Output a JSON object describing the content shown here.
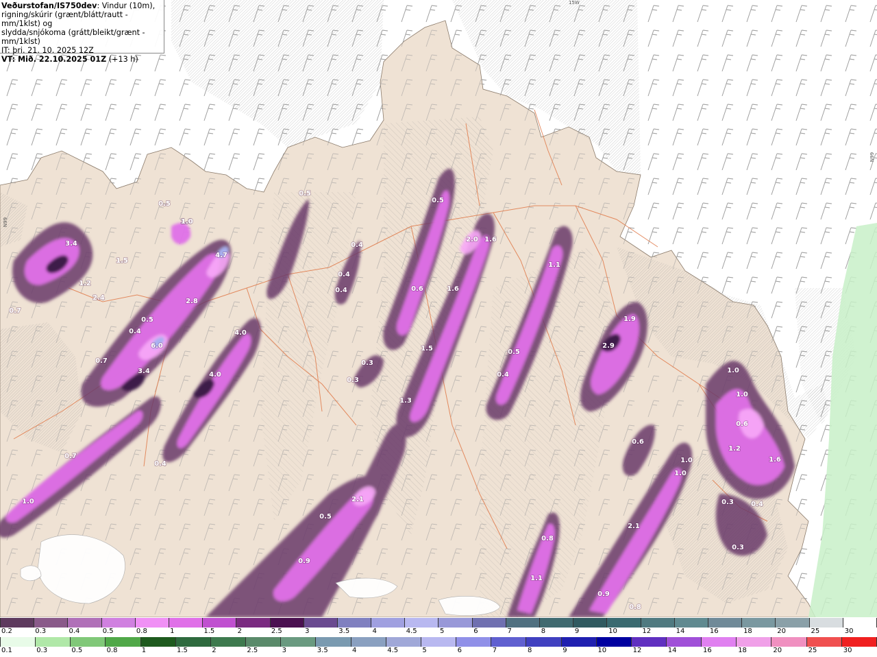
{
  "info": {
    "brand": "Veðurstofan/IS750dev",
    "line1_rest": ": Vindur (10m),",
    "line2": "rigning/skúrir (grænt/blátt/rautt - mm/1klst) og",
    "line3": "slydda/snjókoma (grátt/bleikt/grænt - mm/1klst)",
    "it": "IT: þri. 21. 10. 2025 12Z",
    "vt": "VT: Mið. 22.10.2025 01Z",
    "vt_offset": " (+13 h)"
  },
  "edge_labels": {
    "top": "15W",
    "left": "N99",
    "right": "N99"
  },
  "colors": {
    "sea": "#ffffff",
    "land": "#efe2d4",
    "roads": "#e07a4a",
    "hatch": "#888888",
    "precip_light": "#8a5a8f",
    "precip_mid": "#e070e8",
    "precip_strong": "#f5a0f5",
    "precip_core": "#4a1a50",
    "rain_green": "#c8f0c8"
  },
  "map_labels": [
    {
      "name": "precip-value",
      "text": "0.5"
    },
    {
      "name": "precip-value",
      "text": "1.0"
    },
    {
      "name": "precip-value",
      "text": "0.5"
    },
    {
      "name": "precip-value",
      "text": "3.4"
    },
    {
      "name": "precip-value",
      "text": "1.5"
    },
    {
      "name": "precip-value",
      "text": "1.2"
    },
    {
      "name": "precip-value",
      "text": "2.4"
    },
    {
      "name": "precip-value",
      "text": "0.7"
    },
    {
      "name": "precip-value",
      "text": "4.7"
    },
    {
      "name": "precip-value",
      "text": "2.8"
    },
    {
      "name": "precip-value",
      "text": "0.5"
    },
    {
      "name": "precip-value",
      "text": "0.4"
    },
    {
      "name": "precip-value",
      "text": "6.0"
    },
    {
      "name": "precip-value",
      "text": "0.7"
    },
    {
      "name": "precip-value",
      "text": "3.4"
    },
    {
      "name": "precip-value",
      "text": "4.0"
    },
    {
      "name": "precip-value",
      "text": "4.0"
    },
    {
      "name": "precip-value",
      "text": "0.4"
    },
    {
      "name": "precip-value",
      "text": "0.4"
    },
    {
      "name": "precip-value",
      "text": "0.4"
    },
    {
      "name": "precip-value",
      "text": "0.5"
    },
    {
      "name": "precip-value",
      "text": "2.0"
    },
    {
      "name": "precip-value",
      "text": "1.6"
    },
    {
      "name": "precip-value",
      "text": "0.6"
    },
    {
      "name": "precip-value",
      "text": "1.6"
    },
    {
      "name": "precip-value",
      "text": "1.1"
    },
    {
      "name": "precip-value",
      "text": "1.5"
    },
    {
      "name": "precip-value",
      "text": "0.3"
    },
    {
      "name": "precip-value",
      "text": "0.3"
    },
    {
      "name": "precip-value",
      "text": "1.3"
    },
    {
      "name": "precip-value",
      "text": "0.5"
    },
    {
      "name": "precip-value",
      "text": "0.4"
    },
    {
      "name": "precip-value",
      "text": "1.9"
    },
    {
      "name": "precip-value",
      "text": "2.9"
    },
    {
      "name": "precip-value",
      "text": "0.6"
    },
    {
      "name": "precip-value",
      "text": "1.0"
    },
    {
      "name": "precip-value",
      "text": "1.0"
    },
    {
      "name": "precip-value",
      "text": "0.6"
    },
    {
      "name": "precip-value",
      "text": "1.2"
    },
    {
      "name": "precip-value",
      "text": "1.6"
    },
    {
      "name": "precip-value",
      "text": "1.0"
    },
    {
      "name": "precip-value",
      "text": "1.0"
    },
    {
      "name": "precip-value",
      "text": "0.3"
    },
    {
      "name": "precip-value",
      "text": "0.4"
    },
    {
      "name": "precip-value",
      "text": "0.3"
    },
    {
      "name": "precip-value",
      "text": "2.1"
    },
    {
      "name": "precip-value",
      "text": "0.5"
    },
    {
      "name": "precip-value",
      "text": "0.9"
    },
    {
      "name": "precip-value",
      "text": "0.8"
    },
    {
      "name": "precip-value",
      "text": "1.1"
    },
    {
      "name": "precip-value",
      "text": "2.1"
    },
    {
      "name": "precip-value",
      "text": "0.9"
    },
    {
      "name": "precip-value",
      "text": "0.8"
    },
    {
      "name": "precip-value",
      "text": "1.0"
    },
    {
      "name": "precip-value",
      "text": "0.7"
    },
    {
      "name": "precip-value",
      "text": "0.4"
    },
    {
      "name": "precip-value",
      "text": "1.0"
    }
  ],
  "legend_snow": {
    "labels": [
      "0.2",
      "0.3",
      "0.4",
      "0.5",
      "0.8",
      "1",
      "1.5",
      "2",
      "2.5",
      "3",
      "3.5",
      "4",
      "4.5",
      "5",
      "6",
      "7",
      "8",
      "9",
      "10",
      "12",
      "14",
      "16",
      "18",
      "20",
      "25",
      "30"
    ],
    "colors": [
      "#5e3a5e",
      "#8a5a8a",
      "#b070b8",
      "#d080e0",
      "#f090f5",
      "#e070e8",
      "#c050d0",
      "#7a2a80",
      "#4a1050",
      "#6a4a90",
      "#8080c0",
      "#a0a0e0",
      "#b8b8f0",
      "#9898d8",
      "#7070b0",
      "#507080",
      "#406a70",
      "#305a60",
      "#3a6a70",
      "#507a80",
      "#608a90",
      "#708a98",
      "#7a98a0",
      "#8aa0a8",
      "#d8dde0",
      "#ffffff"
    ]
  },
  "legend_rain": {
    "labels": [
      "0.1",
      "0.3",
      "0.5",
      "0.8",
      "1",
      "1.5",
      "2",
      "2.5",
      "3",
      "3.5",
      "4",
      "4.5",
      "5",
      "6",
      "7",
      "8",
      "9",
      "10",
      "12",
      "14",
      "16",
      "18",
      "20",
      "25",
      "30"
    ],
    "colors": [
      "#e8fbe8",
      "#b0e8a8",
      "#80c878",
      "#50a848",
      "#1e5a1e",
      "#2e6a3e",
      "#3e7a4e",
      "#5a8a6a",
      "#6a9a80",
      "#7a9ab0",
      "#8aa0c0",
      "#a0a8d8",
      "#b8b8f0",
      "#9090e8",
      "#6060d0",
      "#4040c0",
      "#2020b0",
      "#0000a0",
      "#6030c0",
      "#a050d8",
      "#e080f0",
      "#f0a0e8",
      "#f090c0",
      "#f05050",
      "#f02020"
    ]
  }
}
